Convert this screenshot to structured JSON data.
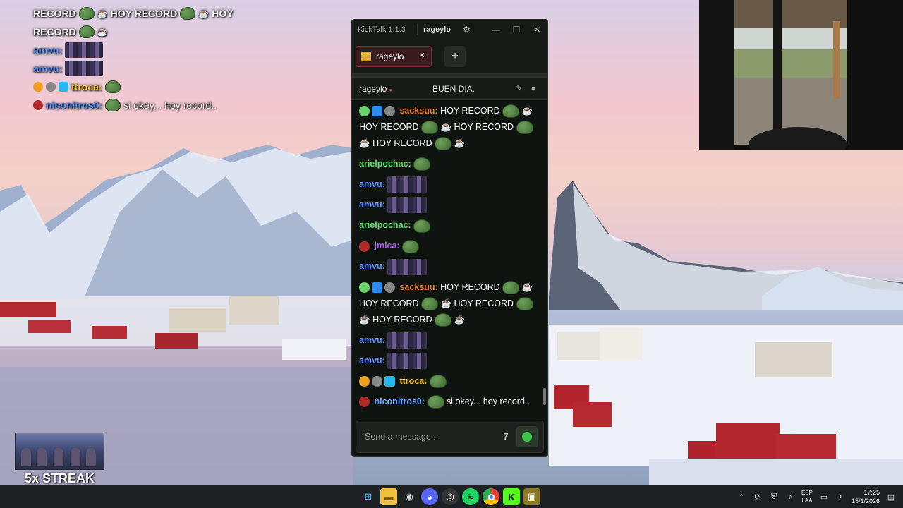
{
  "overlay_chat": {
    "line1": {
      "text_a": "RECORD",
      "text_b": "HOY RECORD",
      "text_c": "HOY"
    },
    "line2": {
      "text": "RECORD"
    },
    "line3": {
      "user": "amvu:"
    },
    "line4": {
      "user": "amvu:"
    },
    "line5": {
      "user": "ttroca:"
    },
    "line6": {
      "user": "niconitros0:",
      "text": "si okey... hoy record.."
    }
  },
  "streak": {
    "label": "5x STREAK"
  },
  "kicktalk": {
    "app_title": "KickTalk 1.1.3",
    "current_user": "rageylo",
    "window_controls": {
      "minimize": "—",
      "maximize": "☐",
      "close": "✕"
    },
    "tab": {
      "label": "rageylo",
      "close": "✕"
    },
    "add_tab": "+",
    "channel": {
      "name": "rageylo",
      "live_dot": "●",
      "stream_title": "BUEN DIA."
    },
    "messages": [
      {
        "user": "sacksuu:",
        "text": "HOY RECORD",
        "text2": "HOY RECORD",
        "text3": "HOY RECORD",
        "text4": "HOY RECORD"
      },
      {
        "user": "arielpochac:"
      },
      {
        "user": "amvu:"
      },
      {
        "user": "amvu:"
      },
      {
        "user": "arielpochac:"
      },
      {
        "user": "jmica:"
      },
      {
        "user": "amvu:"
      },
      {
        "user": "sacksuu:",
        "text": "HOY RECORD",
        "text2": "HOY RECORD",
        "text3": "HOY RECORD",
        "text4": "HOY RECORD"
      },
      {
        "user": "amvu:"
      },
      {
        "user": "amvu:"
      },
      {
        "user": "ttroca:"
      },
      {
        "user": "niconitros0:",
        "text": "si okey... hoy record.."
      }
    ],
    "input": {
      "placeholder": "Send a message...",
      "emote_button": "7",
      "send_icon": "kick-icon"
    }
  },
  "taskbar": {
    "lang_top": "ESP",
    "lang_bottom": "LAA",
    "time": "17:25",
    "date": "15/1/2026",
    "apps": [
      "windows-start-icon",
      "file-explorer-icon",
      "steam-icon",
      "discord-icon",
      "obs-icon",
      "spotify-icon",
      "chrome-icon",
      "kick-icon",
      "kicktalk-icon"
    ]
  },
  "colors": {
    "window_bg": "#0f1410",
    "kick_green": "#3cc34a",
    "tab_red": "#3a1c1e"
  }
}
